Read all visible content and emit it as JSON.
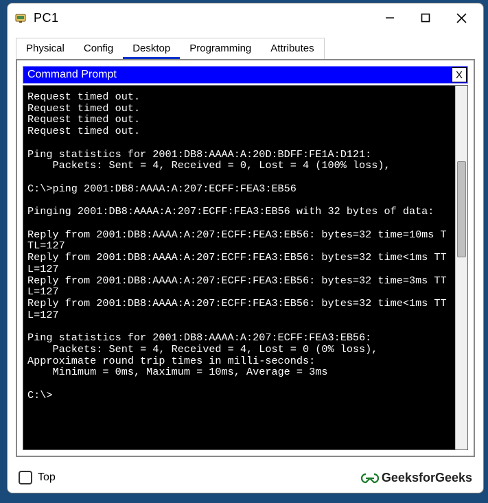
{
  "window": {
    "title": "PC1"
  },
  "tabs": [
    {
      "label": "Physical",
      "active": false
    },
    {
      "label": "Config",
      "active": false
    },
    {
      "label": "Desktop",
      "active": true
    },
    {
      "label": "Programming",
      "active": false
    },
    {
      "label": "Attributes",
      "active": false
    }
  ],
  "command_prompt": {
    "title": "Command Prompt",
    "close_label": "X",
    "output": "Request timed out.\nRequest timed out.\nRequest timed out.\nRequest timed out.\n\nPing statistics for 2001:DB8:AAAA:A:20D:BDFF:FE1A:D121:\n    Packets: Sent = 4, Received = 0, Lost = 4 (100% loss),\n\nC:\\>ping 2001:DB8:AAAA:A:207:ECFF:FEA3:EB56\n\nPinging 2001:DB8:AAAA:A:207:ECFF:FEA3:EB56 with 32 bytes of data:\n\nReply from 2001:DB8:AAAA:A:207:ECFF:FEA3:EB56: bytes=32 time=10ms TTL=127\nReply from 2001:DB8:AAAA:A:207:ECFF:FEA3:EB56: bytes=32 time<1ms TTL=127\nReply from 2001:DB8:AAAA:A:207:ECFF:FEA3:EB56: bytes=32 time=3ms TTL=127\nReply from 2001:DB8:AAAA:A:207:ECFF:FEA3:EB56: bytes=32 time<1ms TTL=127\n\nPing statistics for 2001:DB8:AAAA:A:207:ECFF:FEA3:EB56:\n    Packets: Sent = 4, Received = 4, Lost = 0 (0% loss),\nApproximate round trip times in milli-seconds:\n    Minimum = 0ms, Maximum = 10ms, Average = 3ms\n\nC:\\>"
  },
  "footer": {
    "top_checkbox_label": "Top",
    "brand": "GeeksforGeeks"
  }
}
